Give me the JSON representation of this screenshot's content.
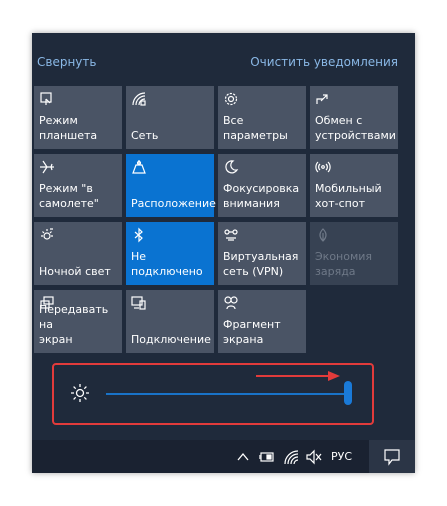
{
  "header": {
    "collapse_label": "Свернуть",
    "clear_label": "Очистить уведомления"
  },
  "tiles": [
    {
      "label": "Режим\nпланшета",
      "icon": "tablet-mode-icon",
      "state": "off"
    },
    {
      "label": "Сеть",
      "icon": "network-icon",
      "state": "off"
    },
    {
      "label": "Все\nпараметры",
      "icon": "gear-icon",
      "state": "off"
    },
    {
      "label": "Обмен с\nустройствами",
      "icon": "share-icon",
      "state": "off"
    },
    {
      "label": "Режим \"в\nсамолете\"",
      "icon": "airplane-icon",
      "state": "off"
    },
    {
      "label": "Расположение",
      "icon": "location-icon",
      "state": "on"
    },
    {
      "label": "Фокусировка\nвнимания",
      "icon": "moon-icon",
      "state": "off"
    },
    {
      "label": "Мобильный\nхот-спот",
      "icon": "hotspot-icon",
      "state": "off"
    },
    {
      "label": "Ночной свет",
      "icon": "night-light-icon",
      "state": "off"
    },
    {
      "label": "Не\nподключено",
      "icon": "bluetooth-icon",
      "state": "on"
    },
    {
      "label": "Виртуальная\nсеть (VPN)",
      "icon": "vpn-icon",
      "state": "off"
    },
    {
      "label": "Экономия\nзаряда",
      "icon": "battery-saver-icon",
      "state": "disabled"
    },
    {
      "label": "Передавать на\nэкран",
      "icon": "project-icon",
      "state": "off"
    },
    {
      "label": "Подключение",
      "icon": "connect-icon",
      "state": "off"
    },
    {
      "label": "Фрагмент\nэкрана",
      "icon": "snip-icon",
      "state": "off"
    }
  ],
  "brightness": {
    "icon": "brightness-icon",
    "value_fraction": 1.0
  },
  "taskbar": {
    "language": "РУС",
    "icons": [
      "chevron-up-icon",
      "battery-icon",
      "wifi-icon",
      "volume-muted-icon",
      "notification-center-icon"
    ]
  },
  "colors": {
    "panel_bg": "#1f2a3b",
    "tile_bg": "#4a5465",
    "tile_active": "#0a73d1",
    "link": "#8ab8e6",
    "highlight": "#e23b3b"
  }
}
